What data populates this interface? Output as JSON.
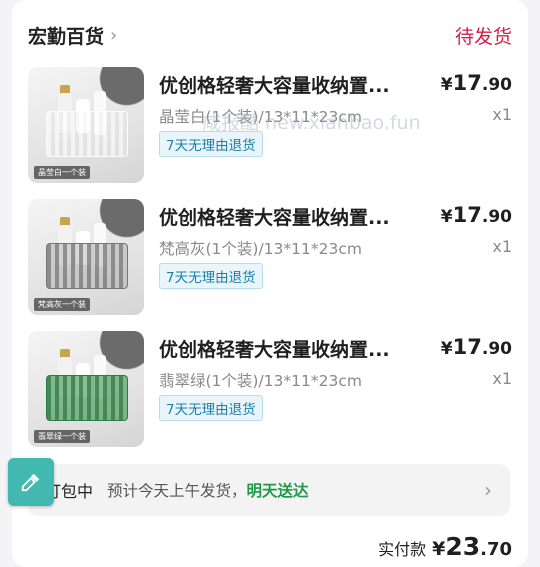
{
  "shop": {
    "name": "宏勤百货",
    "status": "待发货"
  },
  "items": [
    {
      "title": "优创格轻奢大容量收纳置...",
      "price_symbol": "¥",
      "price_int": "17",
      "price_dec": ".90",
      "spec": "晶莹白(1个装)/13*11*23cm",
      "qty": "x1",
      "badge": "7天无理由退货",
      "thumb_tag": "晶莹白一个装"
    },
    {
      "title": "优创格轻奢大容量收纳置...",
      "price_symbol": "¥",
      "price_int": "17",
      "price_dec": ".90",
      "spec": "梵高灰(1个装)/13*11*23cm",
      "qty": "x1",
      "badge": "7天无理由退货",
      "thumb_tag": "梵高灰一个装"
    },
    {
      "title": "优创格轻奢大容量收纳置...",
      "price_symbol": "¥",
      "price_int": "17",
      "price_dec": ".90",
      "spec": "翡翠绿(1个装)/13*11*23cm",
      "qty": "x1",
      "badge": "7天无理由退货",
      "thumb_tag": "翡翠绿一个装"
    }
  ],
  "watermark": "咸报酷 new.xianbao.fun",
  "shipping": {
    "label": "打包中",
    "text": "预计今天上午发货，",
    "highlight": "明天送达"
  },
  "total": {
    "label": "实付款",
    "symbol": "¥",
    "int": "23",
    "dec": ".70"
  },
  "colors": {
    "status": "#d2204b",
    "badge_text": "#1a7fa8",
    "highlight": "#1f9a48",
    "float_button": "#41b8b0"
  },
  "icons": {
    "shop_chevron": "chevron-right-icon",
    "ship_arrow": "chevron-right-icon",
    "float": "eyedropper-icon"
  }
}
